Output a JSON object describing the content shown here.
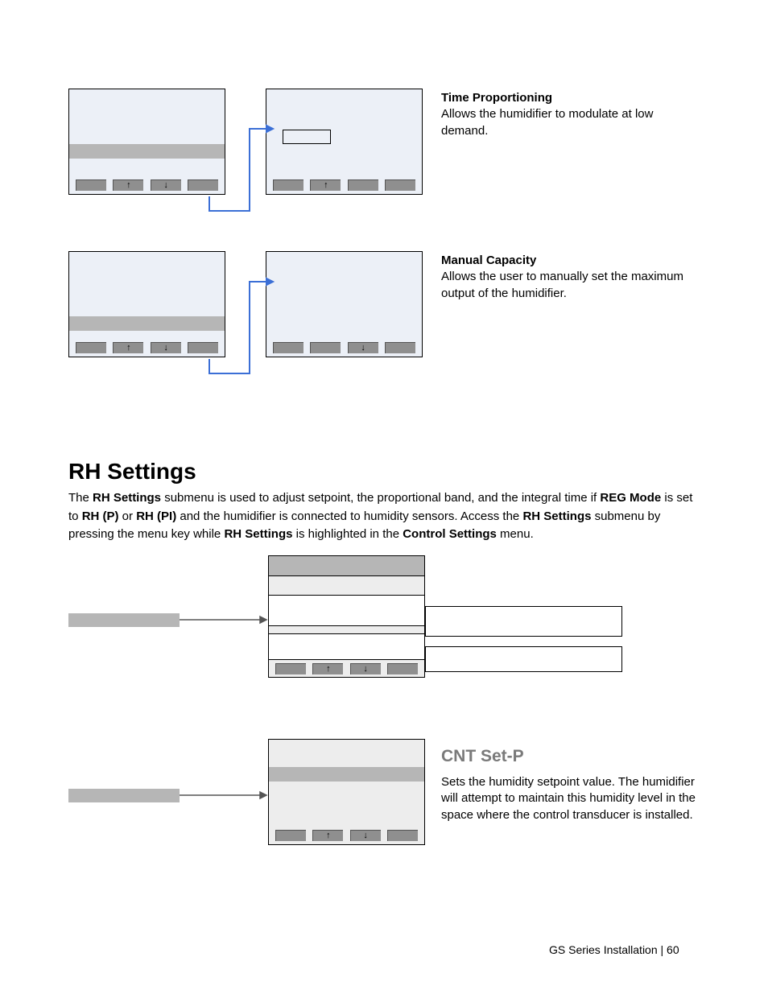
{
  "block1": {
    "title": "Time Proportioning",
    "body": "Allows the humidifier to modulate at low demand."
  },
  "block2": {
    "title": "Manual Capacity",
    "body": "Allows the user to manually set the maximum output of the humidifier."
  },
  "section": {
    "title": "RH Settings",
    "body_parts": {
      "t1": "The ",
      "b1": "RH Settings",
      "t2": " submenu is used to adjust setpoint, the proportional band, and the integral time if ",
      "b2": "REG Mode",
      "t3": " is set to ",
      "b3": "RH (P)",
      "t4": " or ",
      "b4": "RH (PI)",
      "t5": " and the humidifier is connected to humidity sensors.  Access the ",
      "b5": "RH Settings",
      "t6": " submenu by pressing the menu key while ",
      "b6": "RH Settings",
      "t7": " is highlighted in the ",
      "b7": "Control Settings",
      "t8": " menu."
    }
  },
  "cnt": {
    "title": "CNT Set-P",
    "body": "Sets the humidity setpoint value.  The humidifier will attempt to maintain this humidity level in the space where the control transducer is installed."
  },
  "footer": {
    "text": "GS Series Installation  |  60"
  },
  "icons": {
    "up": "↑",
    "down": "↓"
  }
}
